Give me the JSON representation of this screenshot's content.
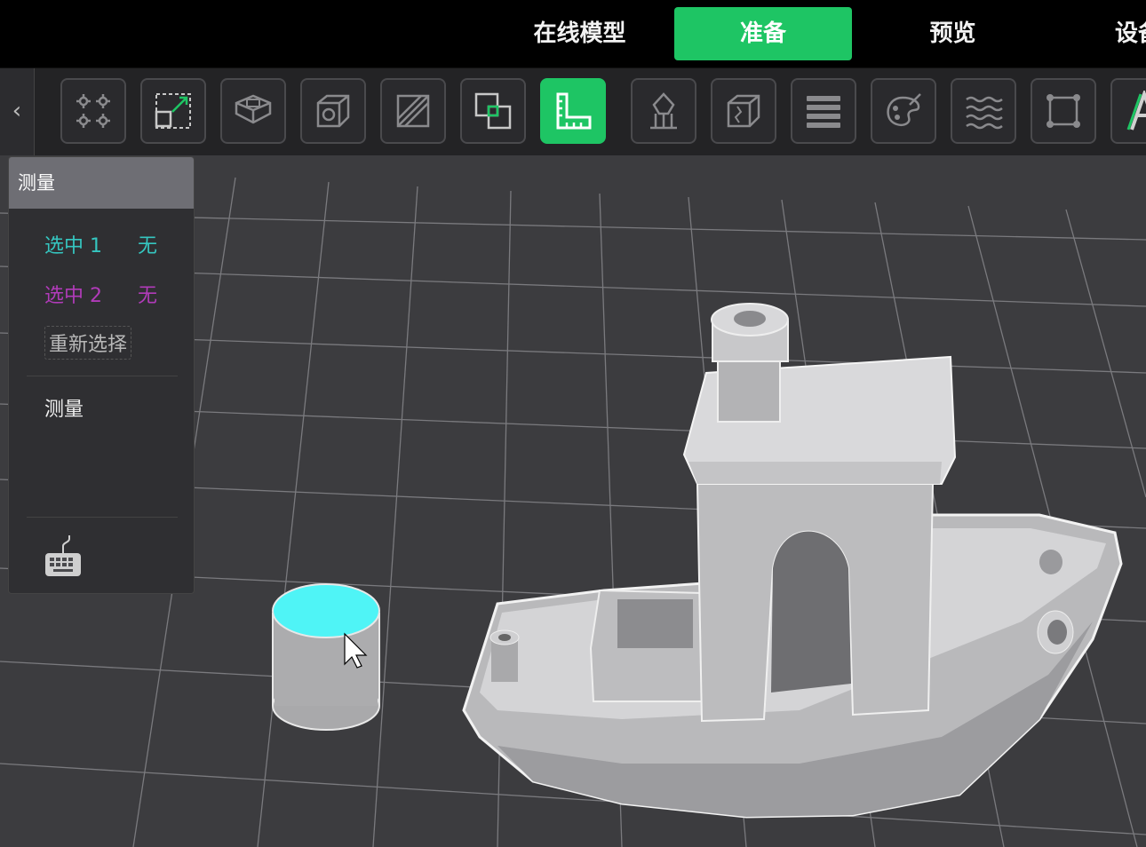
{
  "tabs": [
    {
      "label": "在线模型",
      "active": false
    },
    {
      "label": "准备",
      "active": true
    },
    {
      "label": "预览",
      "active": false
    },
    {
      "label": "设备",
      "active": false
    }
  ],
  "toolbar": {
    "collapse_icon": "‹",
    "tools": [
      {
        "name": "arrange-icon"
      },
      {
        "name": "scale-icon"
      },
      {
        "name": "place-on-face-icon"
      },
      {
        "name": "cut-icon"
      },
      {
        "name": "split-icon"
      },
      {
        "name": "boolean-icon"
      },
      {
        "name": "measure-icon",
        "active": true
      },
      {
        "name": "support-paint-icon"
      },
      {
        "name": "seam-paint-icon"
      },
      {
        "name": "layers-icon"
      },
      {
        "name": "color-paint-icon"
      },
      {
        "name": "fuzzy-skin-icon"
      },
      {
        "name": "assembly-icon"
      },
      {
        "name": "text-icon"
      }
    ]
  },
  "panel": {
    "title": "测量",
    "selection1_label": "选中 1",
    "selection1_value": "无",
    "selection2_label": "选中 2",
    "selection2_value": "无",
    "reselect_label": "重新选择",
    "measure_label": "测量",
    "keyboard_icon": "keyboard-icon"
  },
  "colors": {
    "accent": "#1ec564",
    "selection1": "#35c6c0",
    "selection2": "#b13bb9",
    "highlight_face": "#4ff4f6"
  }
}
